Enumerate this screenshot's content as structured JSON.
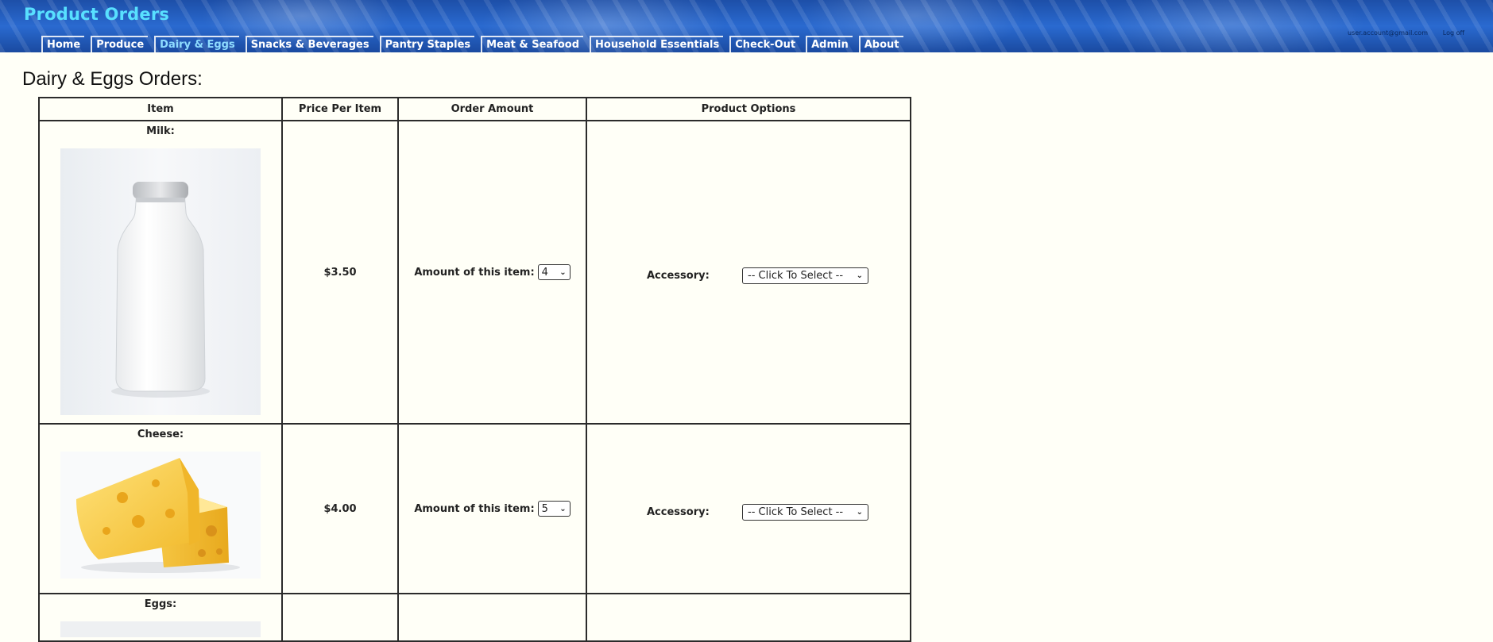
{
  "header": {
    "title": "Product Orders",
    "user_email": "user.account@gmail.com",
    "logoff": "Log off"
  },
  "nav": [
    {
      "label": "Home"
    },
    {
      "label": "Produce"
    },
    {
      "label": "Dairy & Eggs",
      "active": true
    },
    {
      "label": "Snacks & Beverages"
    },
    {
      "label": "Pantry Staples"
    },
    {
      "label": "Meat & Seafood"
    },
    {
      "label": "Household Essentials"
    },
    {
      "label": "Check-Out"
    },
    {
      "label": "Admin"
    },
    {
      "label": "About"
    }
  ],
  "page": {
    "title": "Dairy & Eggs Orders:"
  },
  "table": {
    "headers": [
      "Item",
      "Price Per Item",
      "Order Amount",
      "Product Options"
    ],
    "rows": [
      {
        "name": "Milk:",
        "price": "$3.50",
        "amount_label": "Amount of this item:",
        "amount_value": "4",
        "option_label": "Accessory:",
        "option_value": "-- Click To Select --"
      },
      {
        "name": "Cheese:",
        "price": "$4.00",
        "amount_label": "Amount of this item:",
        "amount_value": "5",
        "option_label": "Accessory:",
        "option_value": "-- Click To Select --"
      },
      {
        "name": "Eggs:"
      }
    ]
  },
  "colors": {
    "header_blue": "#1d4fa8",
    "title_cyan": "#58e0ff",
    "active_nav": "#8fdcff",
    "page_bg": "#fffff7"
  }
}
